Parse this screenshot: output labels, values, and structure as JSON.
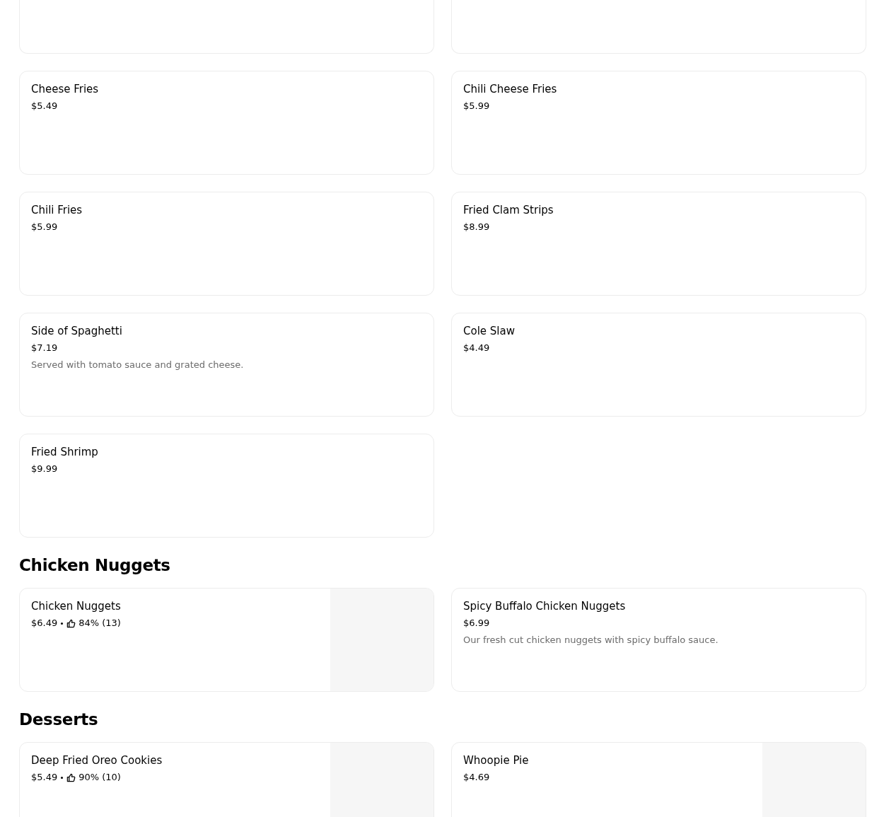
{
  "sections": [
    {
      "items": [
        {
          "name": "Cheese Fries",
          "price": "$5.49"
        },
        {
          "name": "Chili Cheese Fries",
          "price": "$5.99"
        },
        {
          "name": "Chili Fries",
          "price": "$5.99"
        },
        {
          "name": "Fried Clam Strips",
          "price": "$8.99"
        },
        {
          "name": "Side of Spaghetti",
          "price": "$7.19",
          "description": "Served with tomato sauce and grated cheese."
        },
        {
          "name": "Cole Slaw",
          "price": "$4.49"
        },
        {
          "name": "Fried Shrimp",
          "price": "$9.99"
        }
      ]
    },
    {
      "title": "Chicken Nuggets",
      "items": [
        {
          "name": "Chicken Nuggets",
          "price": "$6.49",
          "rating": "84% (13)"
        },
        {
          "name": "Spicy Buffalo Chicken Nuggets",
          "price": "$6.99",
          "description": "Our fresh cut chicken nuggets with spicy buffalo sauce."
        }
      ]
    },
    {
      "title": "Desserts",
      "items": [
        {
          "name": "Deep Fried Oreo Cookies",
          "price": "$5.49",
          "rating": "90% (10)"
        },
        {
          "name": "Whoopie Pie",
          "price": "$4.69"
        }
      ]
    }
  ]
}
